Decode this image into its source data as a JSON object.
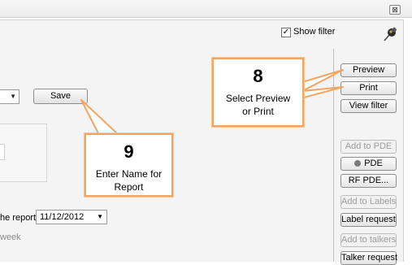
{
  "window": {
    "close_glyph": "⊠"
  },
  "filter": {
    "show_filter_label": "Show filter",
    "checked": true,
    "check_glyph": "✓"
  },
  "form": {
    "save_label": "Save",
    "report_label": "he report",
    "report_date": "11/12/2012",
    "week_label": "week"
  },
  "toolbar": {
    "preview": "Preview",
    "print": "Print",
    "view_filter": "View filter",
    "add_to_pde": "Add to PDE",
    "pde": "PDE",
    "rf_pde": "RF PDE...",
    "add_to_labels": "Add to Labels",
    "label_request": "Label request",
    "add_to_talkers": "Add to talkers",
    "talker_request": "Talker request"
  },
  "callouts": {
    "step8": {
      "number": "8",
      "text_line1": "Select Preview",
      "text_line2": "or Print"
    },
    "step9": {
      "number": "9",
      "text_line1": "Enter Name for",
      "text_line2": "Report"
    }
  },
  "colors": {
    "callout_border": "#f4a460",
    "panel_bg": "#f4f4f4"
  },
  "icons": {
    "pin": "pushpin-icon",
    "close": "close-icon"
  }
}
